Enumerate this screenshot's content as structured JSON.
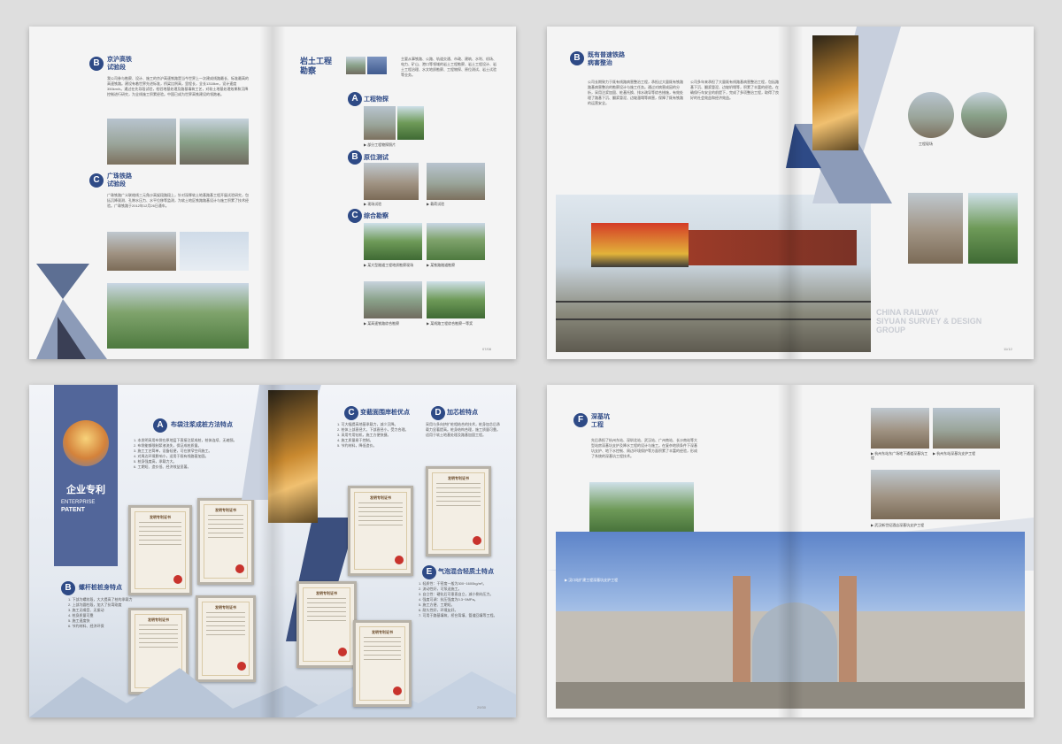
{
  "s1": {
    "sec_b_badge": "B",
    "sec_b_title": "京沪高铁\n试验段",
    "sec_b_text": "我公司参与勘察、设计、施工的京沪高速铁路是当今世界上一次建成线路最长、标准最高的高速铁路。建设有着世界先进标准，桥梁比例高，里程长，全长1318km，设计速度350km/h。通过在先导段试验，检验地基处理及路基填筑工艺，对软土地基处理效果和沉降控制进行研究，为全线施工积累经验。中国已成为世界高铁建设的领跑者。",
    "sec_c_badge": "C",
    "sec_c_title": "广珠铁路\n试验段",
    "sec_c_text": "广珠铁路广义联络线三元角沙高架段路段上，针对深厚软土地基路基工程开展试验研究，包括沉降观测、孔隙水压力、水平位移等监测，为软土地区铁路路基设计与施工积累了技术经验。广珠铁路于2012年12月26日通车。",
    "right_title": "岩土工程\n勘察",
    "right_intro": "主要从事铁路、公路、轨道交通、市政、建筑、水利、机场、电力、矿山、港口等领域的岩土工程勘察、岩土工程设计、岩土工程治理、水文地质勘察、工程物探、原位测试、岩土试验等业务。",
    "sub_a_badge": "A",
    "sub_a_title": "工程物探",
    "sub_a_cap": "▶ 部分工程物探照片",
    "sub_b_badge": "B",
    "sub_b_title": "原位测试",
    "sub_b_cap1": "▶ 现场试验",
    "sub_b_cap2": "▶ 载荷试验",
    "sub_c_badge": "C",
    "sub_c_title": "综合勘察",
    "sub_c_cap1": "▶ 某大型隧道工程地质勘察现场",
    "sub_c_cap2": "▶ 某铁路隧道勘察",
    "sub_c_cap3": "▶ 某高速铁路综合勘察",
    "sub_c_cap4": "▶ 某线路工程综合勘察一等奖",
    "page_num": "07/08"
  },
  "s2": {
    "badge": "B",
    "title": "既有普速铁路\n病害整治",
    "text_left": "公司长期致力于既有线路病害整治工程，承担过大量既有铁路路基病害整治的勘察设计与施工任务。通过对病害成因的分析，采用注浆加固、桩基托换、排水疏导等综合措施，有效处理了路基下沉、翻浆冒泥、边坡溜塌等病害，保障了既有铁路的运营安全。",
    "text_right": "公司多年来承担了大量既有线路基病害整治工程，包括路基下沉、翻浆冒泥、边坡坍塌等，积累了丰富的经验。在确保行车安全的前提下，完成了多项整治工程，取得了良好的社会效益和经济效益。",
    "small_caption": "工程现场",
    "watermark": "CHINA RAILWAY\nSIYUAN SURVEY & DESIGN\nGROUP",
    "page_num": "11/12"
  },
  "s3": {
    "patent_title": "企业专利",
    "patent_en_1": "ENTERPRISE",
    "patent_en_2": "PATENT",
    "a_badge": "A",
    "a_title": "布袋注浆成桩方法特点",
    "a_text": "1. 本发明采用布袋在原地层下直接注浆成桩，桩体连续、无缩颈。\n2. 布袋能够限制浆液流失，保证成桩质量。\n3. 施工工艺简单，设备轻便，可在狭窄空间施工。\n4. 对周边环境影响小，适用于既有线路基加固。\n5. 桩身强度高，承载力大。\n6. 工期短、造价低、经济效益显著。",
    "b_badge": "B",
    "b_title": "螺杆桩桩身特点",
    "b_text": "1. 下部为螺纹段，大大提高了桩的承载力\n2. 上部为圆柱段，加大了抗弯刚度\n3. 施工无噪音、无振动\n4. 桩身质量可靠\n5. 施工速度快\n6. 节约材料、经济环保",
    "c_badge": "C",
    "c_title": "变截面围岸桩优点",
    "c_text": "1. 可大幅提高地基承载力，减少沉降。\n2. 桩体上部直径大，下部直径小，受力合理。\n3. 采用专用钻机，施工方便快捷。\n4. 施工质量易于控制。\n5. 节约材料，降低造价。",
    "d_badge": "D",
    "d_title": "加芯桩特点",
    "d_text": "采用与多向挤扩桩相结合的技术，桩身加芯后承载力显著提高。桩身结构合理，施工质量可靠。适用于软土地基处理及路基加固工程。",
    "e_badge": "E",
    "e_title": "气泡混合轻质土特点",
    "e_text": "1. 轻质性：干密度一般为300~1600kg/m³。\n2. 流动性好，可泵送施工。\n3. 自立性：硬化后可垂直自立，减小侧向压力。\n4. 强度可调：抗压强度为0.3~5MPa。\n5. 施工方便、工期短。\n6. 耐久性好，环境友好。\n7. 可用于路基填筑、桥台背填、管道回填等工程。",
    "cert_title": "发明专利证书",
    "page_num": "29/30"
  },
  "s4": {
    "badge": "F",
    "title": "深基坑\n工程",
    "text": "先后承担了杭州东站、深圳北站、武汉站、广州南站、长沙南站等大型站房深基坑支护及降水工程的设计与施工。在复杂地质条件下深基坑支护、地下水控制、周边环境保护等方面积累了丰富的经验，形成了系统的深基坑工程技术。",
    "cap_station": "▶ 深圳北站基坑支护工程",
    "cap_right1": "▶ 杭州东站东广场地下通道深基坑工程",
    "cap_right2": "▶ 杭州东站深基坑支护工程",
    "cap_right3": "▶ 武汉新世纪酒店深基坑支护工程",
    "cap_bottom": "▶ 汉口站扩建工程深基坑支护工程"
  },
  "colors": {
    "accent": "#2e4a86",
    "cert_seal": "#c8332d"
  }
}
